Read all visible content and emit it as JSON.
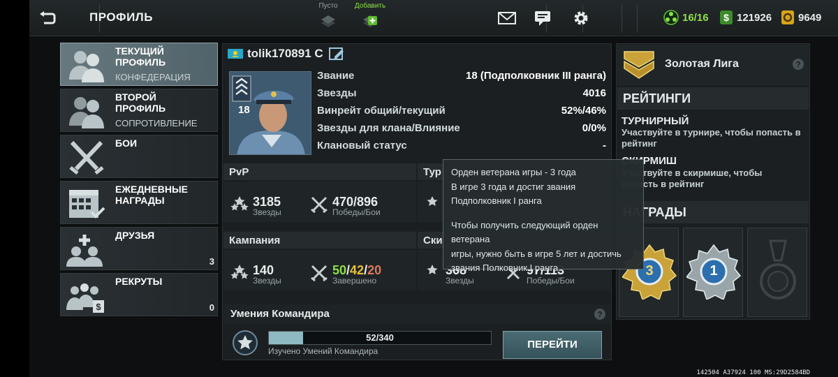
{
  "topbar": {
    "title": "ПРОФИЛЬ",
    "slot_empty_label": "Пусто",
    "slot_add_label": "Добавить",
    "resources": [
      {
        "icon": "energy-icon",
        "value": "16/16",
        "color": "#8ee04a"
      },
      {
        "icon": "dollar-icon",
        "value": "121926",
        "color": "#e8ecec"
      },
      {
        "icon": "gold-icon",
        "value": "9649",
        "color": "#e8ecec"
      }
    ]
  },
  "menu": {
    "items": [
      {
        "title": "ТЕКУЩИЙ ПРОФИЛЬ",
        "subtitle": "КОНФЕДЕРАЦИЯ"
      },
      {
        "title": "ВТОРОЙ ПРОФИЛЬ",
        "subtitle": "СОПРОТИВЛЕНИЕ"
      },
      {
        "title": "БОИ"
      },
      {
        "title": "ЕЖЕДНЕВНЫЕ НАГРАДЫ"
      },
      {
        "title": "ДРУЗЬЯ",
        "count": "3"
      },
      {
        "title": "РЕКРУТЫ",
        "count": "0"
      }
    ]
  },
  "profile": {
    "username": "tolik170891 C",
    "rank_number": "18",
    "stats": [
      {
        "key": "Звание",
        "value": "18 (Подполковник III ранга)"
      },
      {
        "key": "Звезды",
        "value": "4016"
      },
      {
        "key": "Винрейт общий/текущий",
        "value": "52%/46%"
      },
      {
        "key": "Звезды для клана/Влияние",
        "value": "0/0%"
      },
      {
        "key": "Клановый статус",
        "value": "-"
      }
    ]
  },
  "modes": {
    "pvp": {
      "title": "PvP",
      "stars": "3185",
      "stars_label": "Звезды",
      "battles": "470/896",
      "battles_label": "Победы/Бои"
    },
    "tournament": {
      "title": "Тур"
    },
    "campaign": {
      "title": "Кампания",
      "stars": "140",
      "stars_label": "Звезды",
      "done_a": "50",
      "done_b": "42",
      "done_c": "20",
      "done_sep": "/",
      "done_label": "Завершено"
    },
    "skirmish": {
      "title": "Ски",
      "stars": "368",
      "stars_label": "Звезды",
      "battles": "97/113",
      "battles_label": "Победы/Бои"
    }
  },
  "skills": {
    "title": "Умения Командира",
    "progress_text": "52/340",
    "progress_value": 52,
    "progress_max": 340,
    "caption": "Изучено Умений Командира",
    "go_label": "ПЕРЕЙТИ"
  },
  "right": {
    "league": "Золотая Лига",
    "ratings_header": "РЕЙТИНГИ",
    "tournament_title": "ТУРНИРНЫЙ",
    "tournament_desc": "Участвуйте в турнире, чтобы попасть в рейтинг",
    "skirmish_title": "СКИРМИШ",
    "skirmish_desc_1": "Участвуйте в скирмише, чтобы",
    "skirmish_desc_2": "попасть в рейтинг",
    "awards_header": "НАГРАДЫ",
    "award_gold_number": "3",
    "award_silver_number": "1"
  },
  "tooltip": {
    "line1": "Орден ветерана игры - 3 года",
    "line2": "В игре 3 года и достиг звания",
    "line3": "Подполковник I ранга",
    "line4": "Чтобы получить следующий орден ветерана",
    "line5": "игры, нужно быть в игре 5 лет и достичь",
    "line6": "звания Полковник I ранга."
  },
  "build_info": "142504 A37924 100 MS:29D2584BD"
}
